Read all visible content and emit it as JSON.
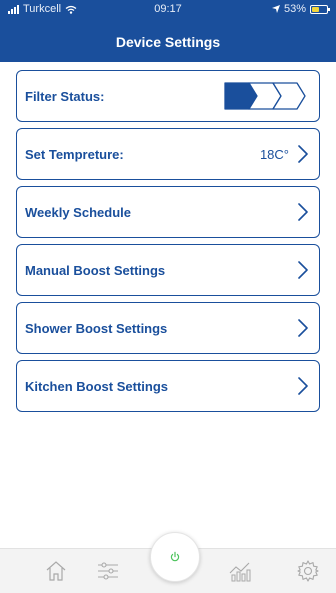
{
  "status_bar": {
    "carrier": "Turkcell",
    "time": "09:17",
    "battery": "53%",
    "battery_level": 0.53
  },
  "header": {
    "title": "Device Settings"
  },
  "settings": {
    "filter_status": {
      "label": "Filter Status:",
      "filled_segments": 1,
      "total_segments": 3
    },
    "temperature": {
      "label": "Set Tempreture:",
      "value": "18C°"
    },
    "weekly_schedule": {
      "label": "Weekly Schedule"
    },
    "manual_boost": {
      "label": "Manual Boost Settings"
    },
    "shower_boost": {
      "label": "Shower Boost Settings"
    },
    "kitchen_boost": {
      "label": "Kitchen Boost Settings"
    }
  },
  "tab_bar": {
    "items": [
      {
        "icon": "home-icon"
      },
      {
        "icon": "sliders-icon"
      },
      {
        "icon": "power-icon"
      },
      {
        "icon": "stats-icon"
      },
      {
        "icon": "gear-icon"
      }
    ]
  },
  "colors": {
    "primary": "#1a4f9c",
    "status_bar_battery": "#f2d53c",
    "tab_icon": "#a9a9a9",
    "power_icon": "#4cc35c"
  }
}
